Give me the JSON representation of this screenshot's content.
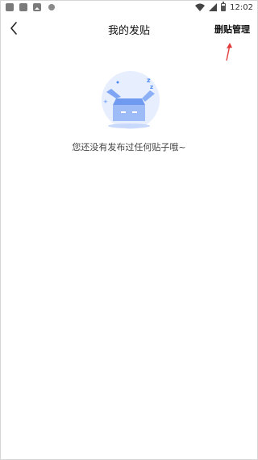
{
  "status_bar": {
    "time": "12:02",
    "icons": [
      "app-icon",
      "app-icon",
      "image-icon",
      "dot-icon",
      "wifi-icon",
      "signal-icon",
      "battery-icon"
    ]
  },
  "header": {
    "title": "我的发贴",
    "manage_label": "删贴管理"
  },
  "empty_state": {
    "message": "您还没有发布过任何贴子哦~"
  },
  "colors": {
    "accent_blue": "#4e88f0",
    "light_blue": "#e7efff",
    "arrow_red": "#e23b3b"
  }
}
